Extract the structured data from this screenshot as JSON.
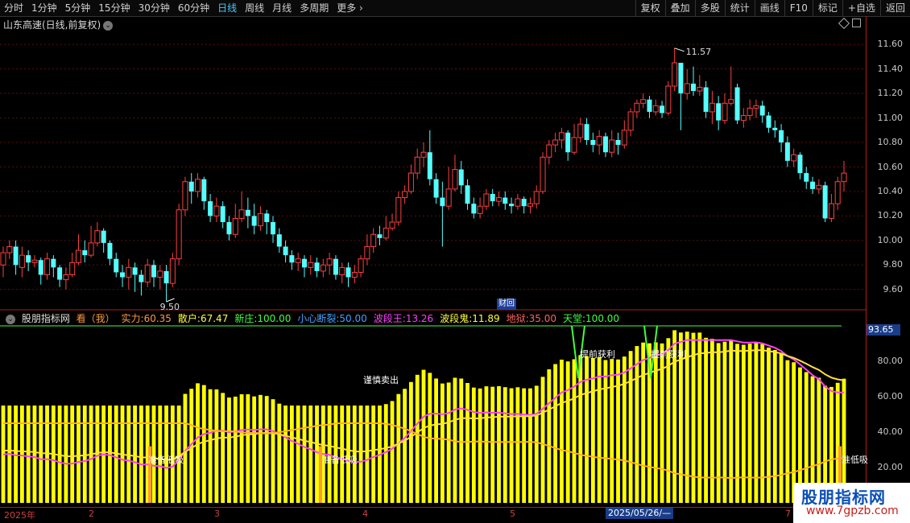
{
  "toolbar": {
    "periods": [
      "分时",
      "1分钟",
      "5分钟",
      "15分钟",
      "30分钟",
      "60分钟",
      "日线",
      "周线",
      "月线",
      "多周期",
      "更多"
    ],
    "active_period": "日线",
    "more_arrow": "›",
    "right": [
      "复权",
      "叠加",
      "多股",
      "统计",
      "画线",
      "F10",
      "标记",
      "+自选",
      "返回"
    ]
  },
  "title": {
    "name": "山东高速(日线,前复权)",
    "chevron": "⌄"
  },
  "price_axis": {
    "ticks": [
      "11.60",
      "11.40",
      "11.20",
      "11.00",
      "10.80",
      "10.60",
      "10.40",
      "10.20",
      "10.00",
      "9.80",
      "9.60"
    ]
  },
  "annotations": {
    "high": "11.57",
    "low": "9.50",
    "caihui": "财回"
  },
  "indicator": {
    "name": "股朋指标网",
    "view": "看（我）",
    "items": [
      {
        "label": "实力:",
        "value": "60.35",
        "color": "#ff9a3c"
      },
      {
        "label": "散户:",
        "value": "67.47",
        "color": "#ffff40"
      },
      {
        "label": "新庄:",
        "value": "100.00",
        "color": "#40ff40"
      },
      {
        "label": "小心断裂:",
        "value": "50.00",
        "color": "#40a0ff"
      },
      {
        "label": "波段王:",
        "value": "13.26",
        "color": "#ff40ff"
      },
      {
        "label": "波段鬼:",
        "value": "11.89",
        "color": "#ffff40"
      },
      {
        "label": "地狱:",
        "value": "35.00",
        "color": "#ff6060"
      },
      {
        "label": "天堂:",
        "value": "100.00",
        "color": "#40ff40"
      }
    ],
    "axis_ticks": [
      "80.00",
      "60.00",
      "40.00",
      "20.00"
    ],
    "current_value": "93.65",
    "signal_low": "准备低吸",
    "signal_low_right": "准低吸",
    "signal_high_1": "谨慎卖出",
    "signal_high_2": "提前获利"
  },
  "date_axis": {
    "labels": [
      "2025年",
      "2",
      "3",
      "4",
      "5",
      "6",
      "7"
    ],
    "current": "2025/05/26/—"
  },
  "watermark": {
    "title": "股朋指标网",
    "url": "www.7gpzb.com"
  },
  "colors": {
    "up": "#ff4040",
    "down": "#54ffff",
    "bar": "#ffff00",
    "magenta": "#ff40ff"
  },
  "chart_data": {
    "type": "candlestick",
    "ylim": [
      9.5,
      11.7
    ],
    "candles": [
      [
        9.8,
        9.9,
        9.95,
        9.7
      ],
      [
        9.9,
        9.95,
        10.0,
        9.85
      ],
      [
        9.95,
        9.8,
        10.0,
        9.72
      ],
      [
        9.78,
        9.88,
        9.95,
        9.7
      ],
      [
        9.88,
        9.82,
        9.92,
        9.75
      ],
      [
        9.82,
        9.84,
        9.88,
        9.78
      ],
      [
        9.84,
        9.72,
        9.86,
        9.64
      ],
      [
        9.72,
        9.85,
        9.9,
        9.68
      ],
      [
        9.85,
        9.78,
        9.88,
        9.7
      ],
      [
        9.78,
        9.68,
        9.8,
        9.62
      ],
      [
        9.68,
        9.72,
        9.78,
        9.6
      ],
      [
        9.72,
        9.82,
        9.9,
        9.7
      ],
      [
        9.82,
        9.92,
        10.05,
        9.8
      ],
      [
        9.92,
        9.88,
        10.0,
        9.82
      ],
      [
        9.88,
        9.98,
        10.12,
        9.86
      ],
      [
        9.98,
        10.08,
        10.15,
        9.95
      ],
      [
        10.08,
        9.98,
        10.1,
        9.9
      ],
      [
        9.98,
        9.85,
        10.0,
        9.8
      ],
      [
        9.85,
        9.74,
        9.9,
        9.7
      ],
      [
        9.74,
        9.7,
        9.8,
        9.62
      ],
      [
        9.7,
        9.78,
        9.85,
        9.6
      ],
      [
        9.78,
        9.72,
        9.82,
        9.58
      ],
      [
        9.72,
        9.66,
        9.76,
        9.55
      ],
      [
        9.66,
        9.8,
        9.85,
        9.62
      ],
      [
        9.8,
        9.7,
        9.84,
        9.62
      ],
      [
        9.7,
        9.75,
        9.8,
        9.6
      ],
      [
        9.75,
        9.65,
        9.8,
        9.5
      ],
      [
        9.65,
        9.85,
        9.9,
        9.62
      ],
      [
        9.85,
        10.25,
        10.3,
        9.8
      ],
      [
        10.25,
        10.48,
        10.52,
        10.2
      ],
      [
        10.48,
        10.4,
        10.55,
        10.3
      ],
      [
        10.4,
        10.5,
        10.55,
        10.35
      ],
      [
        10.5,
        10.32,
        10.52,
        10.25
      ],
      [
        10.32,
        10.2,
        10.38,
        10.15
      ],
      [
        10.2,
        10.28,
        10.35,
        10.15
      ],
      [
        10.28,
        10.15,
        10.32,
        10.1
      ],
      [
        10.15,
        10.05,
        10.2,
        10.0
      ],
      [
        10.05,
        10.18,
        10.3,
        10.02
      ],
      [
        10.18,
        10.25,
        10.4,
        10.15
      ],
      [
        10.25,
        10.2,
        10.35,
        10.1
      ],
      [
        10.2,
        10.12,
        10.3,
        10.05
      ],
      [
        10.12,
        10.22,
        10.28,
        10.08
      ],
      [
        10.22,
        10.15,
        10.25,
        10.05
      ],
      [
        10.15,
        10.05,
        10.2,
        9.98
      ],
      [
        10.05,
        9.95,
        10.1,
        9.9
      ],
      [
        9.95,
        9.88,
        10.0,
        9.82
      ],
      [
        9.88,
        9.82,
        9.92,
        9.76
      ],
      [
        9.82,
        9.85,
        9.9,
        9.75
      ],
      [
        9.85,
        9.78,
        9.88,
        9.7
      ],
      [
        9.78,
        9.82,
        9.88,
        9.72
      ],
      [
        9.82,
        9.75,
        9.86,
        9.7
      ],
      [
        9.75,
        9.8,
        9.85,
        9.7
      ],
      [
        9.8,
        9.85,
        9.9,
        9.72
      ],
      [
        9.85,
        9.72,
        9.88,
        9.68
      ],
      [
        9.72,
        9.78,
        9.82,
        9.65
      ],
      [
        9.78,
        9.7,
        9.82,
        9.62
      ],
      [
        9.7,
        9.74,
        9.8,
        9.65
      ],
      [
        9.74,
        9.85,
        9.88,
        9.7
      ],
      [
        9.85,
        9.95,
        10.05,
        9.8
      ],
      [
        9.95,
        10.05,
        10.1,
        9.9
      ],
      [
        10.05,
        10.02,
        10.12,
        9.96
      ],
      [
        10.02,
        10.1,
        10.2,
        10.0
      ],
      [
        10.1,
        10.15,
        10.22,
        10.08
      ],
      [
        10.15,
        10.35,
        10.4,
        10.12
      ],
      [
        10.35,
        10.4,
        10.45,
        10.3
      ],
      [
        10.4,
        10.55,
        10.62,
        10.38
      ],
      [
        10.55,
        10.68,
        10.75,
        10.5
      ],
      [
        10.68,
        10.72,
        10.8,
        10.6
      ],
      [
        10.72,
        10.5,
        10.9,
        10.45
      ],
      [
        10.5,
        10.35,
        10.55,
        10.3
      ],
      [
        10.35,
        10.28,
        10.48,
        9.95
      ],
      [
        10.28,
        10.42,
        10.6,
        10.25
      ],
      [
        10.42,
        10.58,
        10.7,
        10.4
      ],
      [
        10.58,
        10.45,
        10.65,
        10.38
      ],
      [
        10.45,
        10.3,
        10.5,
        10.25
      ],
      [
        10.3,
        10.22,
        10.35,
        10.18
      ],
      [
        10.22,
        10.28,
        10.35,
        10.18
      ],
      [
        10.28,
        10.38,
        10.42,
        10.25
      ],
      [
        10.38,
        10.32,
        10.42,
        10.28
      ],
      [
        10.32,
        10.35,
        10.4,
        10.28
      ],
      [
        10.35,
        10.3,
        10.4,
        10.25
      ],
      [
        10.3,
        10.28,
        10.35,
        10.22
      ],
      [
        10.28,
        10.34,
        10.38,
        10.25
      ],
      [
        10.34,
        10.28,
        10.36,
        10.22
      ],
      [
        10.28,
        10.3,
        10.35,
        10.22
      ],
      [
        10.3,
        10.4,
        10.45,
        10.26
      ],
      [
        10.4,
        10.68,
        10.72,
        10.38
      ],
      [
        10.68,
        10.78,
        10.82,
        10.62
      ],
      [
        10.78,
        10.82,
        10.88,
        10.72
      ],
      [
        10.82,
        10.88,
        10.92,
        10.75
      ],
      [
        10.88,
        10.72,
        10.9,
        10.65
      ],
      [
        10.72,
        10.84,
        10.95,
        10.7
      ],
      [
        10.84,
        10.95,
        11.0,
        10.8
      ],
      [
        10.95,
        10.82,
        11.0,
        10.78
      ],
      [
        10.82,
        10.78,
        10.88,
        10.72
      ],
      [
        10.78,
        10.85,
        10.9,
        10.7
      ],
      [
        10.85,
        10.72,
        10.88,
        10.68
      ],
      [
        10.72,
        10.82,
        10.9,
        10.68
      ],
      [
        10.82,
        10.78,
        10.88,
        10.7
      ],
      [
        10.78,
        10.9,
        10.98,
        10.75
      ],
      [
        10.9,
        11.05,
        11.08,
        10.85
      ],
      [
        11.05,
        11.12,
        11.15,
        11.0
      ],
      [
        11.12,
        11.15,
        11.2,
        11.08
      ],
      [
        11.15,
        11.05,
        11.18,
        11.0
      ],
      [
        11.05,
        11.1,
        11.15,
        11.02
      ],
      [
        11.1,
        11.04,
        11.14,
        11.0
      ],
      [
        11.04,
        11.26,
        11.3,
        11.02
      ],
      [
        11.26,
        11.45,
        11.57,
        11.22
      ],
      [
        11.45,
        11.2,
        11.45,
        10.9
      ],
      [
        11.2,
        11.28,
        11.4,
        11.15
      ],
      [
        11.28,
        11.22,
        11.42,
        11.18
      ],
      [
        11.22,
        11.25,
        11.35,
        11.18
      ],
      [
        11.25,
        11.05,
        11.3,
        11.0
      ],
      [
        11.05,
        11.12,
        11.22,
        10.95
      ],
      [
        11.12,
        10.98,
        11.18,
        10.9
      ],
      [
        10.98,
        11.12,
        11.2,
        10.95
      ],
      [
        11.12,
        11.15,
        11.42,
        11.1
      ],
      [
        11.25,
        10.98,
        11.28,
        10.95
      ],
      [
        10.98,
        11.02,
        11.08,
        10.92
      ],
      [
        11.02,
        11.08,
        11.15,
        10.98
      ],
      [
        11.08,
        11.1,
        11.15,
        11.0
      ],
      [
        11.1,
        11.02,
        11.14,
        10.96
      ],
      [
        11.02,
        10.92,
        11.05,
        10.88
      ],
      [
        10.92,
        10.9,
        10.98,
        10.84
      ],
      [
        10.9,
        10.8,
        10.95,
        10.72
      ],
      [
        10.8,
        10.65,
        10.85,
        10.6
      ],
      [
        10.65,
        10.7,
        10.75,
        10.6
      ],
      [
        10.7,
        10.55,
        10.72,
        10.5
      ],
      [
        10.55,
        10.48,
        10.6,
        10.42
      ],
      [
        10.48,
        10.42,
        10.52,
        10.38
      ],
      [
        10.42,
        10.45,
        10.5,
        10.38
      ],
      [
        10.45,
        10.18,
        10.48,
        10.15
      ],
      [
        10.18,
        10.3,
        10.38,
        10.15
      ],
      [
        10.3,
        10.48,
        10.52,
        10.25
      ],
      [
        10.48,
        10.55,
        10.65,
        10.4
      ]
    ]
  }
}
